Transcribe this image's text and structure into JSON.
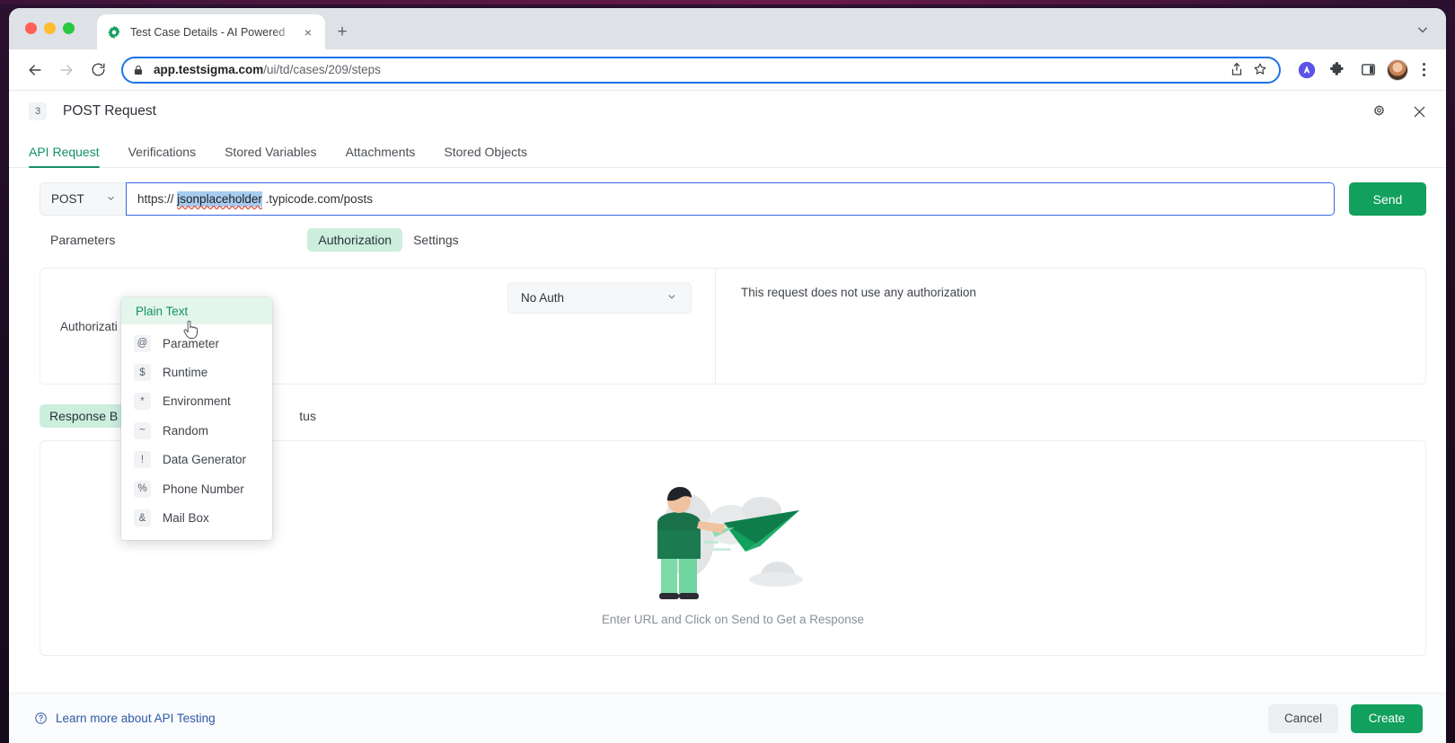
{
  "browser": {
    "tab": {
      "favicon": "testsigma-gear-icon",
      "title": "Test Case Details - AI Powered",
      "close_label": "×"
    },
    "newtab_label": "+",
    "url_prefix": "app.testsigma.com",
    "url_path": "/ui/td/cases/209/steps",
    "toolbar_icons": [
      "back-arrow-icon",
      "forward-arrow-icon",
      "reload-icon",
      "lock-icon",
      "share-icon",
      "bookmark-star-icon",
      "ai-extension-icon",
      "extensions-puzzle-icon",
      "side-panel-icon",
      "profile-avatar",
      "browser-menu-kebab-icon"
    ]
  },
  "step": {
    "number": "3",
    "title": "POST Request",
    "gear_icon": "gear-icon",
    "close_icon": "close-icon"
  },
  "tabs": [
    {
      "label": "API Request",
      "active": true
    },
    {
      "label": "Verifications",
      "active": false
    },
    {
      "label": "Stored Variables",
      "active": false
    },
    {
      "label": "Attachments",
      "active": false
    },
    {
      "label": "Stored Objects",
      "active": false
    }
  ],
  "request": {
    "method": "POST",
    "url_prefix": "https://",
    "url_selected": "jsonplaceholder",
    "url_suffix": ".typicode.com/posts",
    "send_label": "Send"
  },
  "subtabs": [
    {
      "label": "Parameters",
      "style": "plain"
    },
    {
      "label": "Authorization",
      "style": "pill"
    },
    {
      "label": "Settings",
      "style": "plain"
    }
  ],
  "authorization": {
    "label": "Authorizati",
    "selected": "No Auth",
    "chevron": "chevron-down-icon",
    "description": "This request does not use any authorization"
  },
  "response_tabs": [
    {
      "label": "Response B",
      "style": "pill"
    },
    {
      "label": "tus",
      "style": "plain"
    }
  ],
  "response": {
    "illustration": "person-launching-paper-plane-illustration",
    "empty_text": "Enter URL and Click on Send to Get a Response"
  },
  "footer": {
    "learn_icon": "question-circle-icon",
    "learn_label": "Learn more about API Testing",
    "cancel_label": "Cancel",
    "create_label": "Create"
  },
  "dropdown": {
    "header": "Plain Text",
    "items": [
      {
        "badge": "@",
        "label": "Parameter"
      },
      {
        "badge": "$",
        "label": "Runtime"
      },
      {
        "badge": "*",
        "label": "Environment"
      },
      {
        "badge": "~",
        "label": "Random"
      },
      {
        "badge": "!",
        "label": "Data Generator"
      },
      {
        "badge": "%",
        "label": "Phone Number"
      },
      {
        "badge": "&",
        "label": "Mail Box"
      }
    ]
  },
  "colors": {
    "brand_green": "#12a05e",
    "accent_green": "#12916a",
    "pill_green": "#cdeedd",
    "link_blue": "#2e5aa8",
    "omnibox_blue": "#1a73e8",
    "selection_blue": "#a8ccf0"
  }
}
